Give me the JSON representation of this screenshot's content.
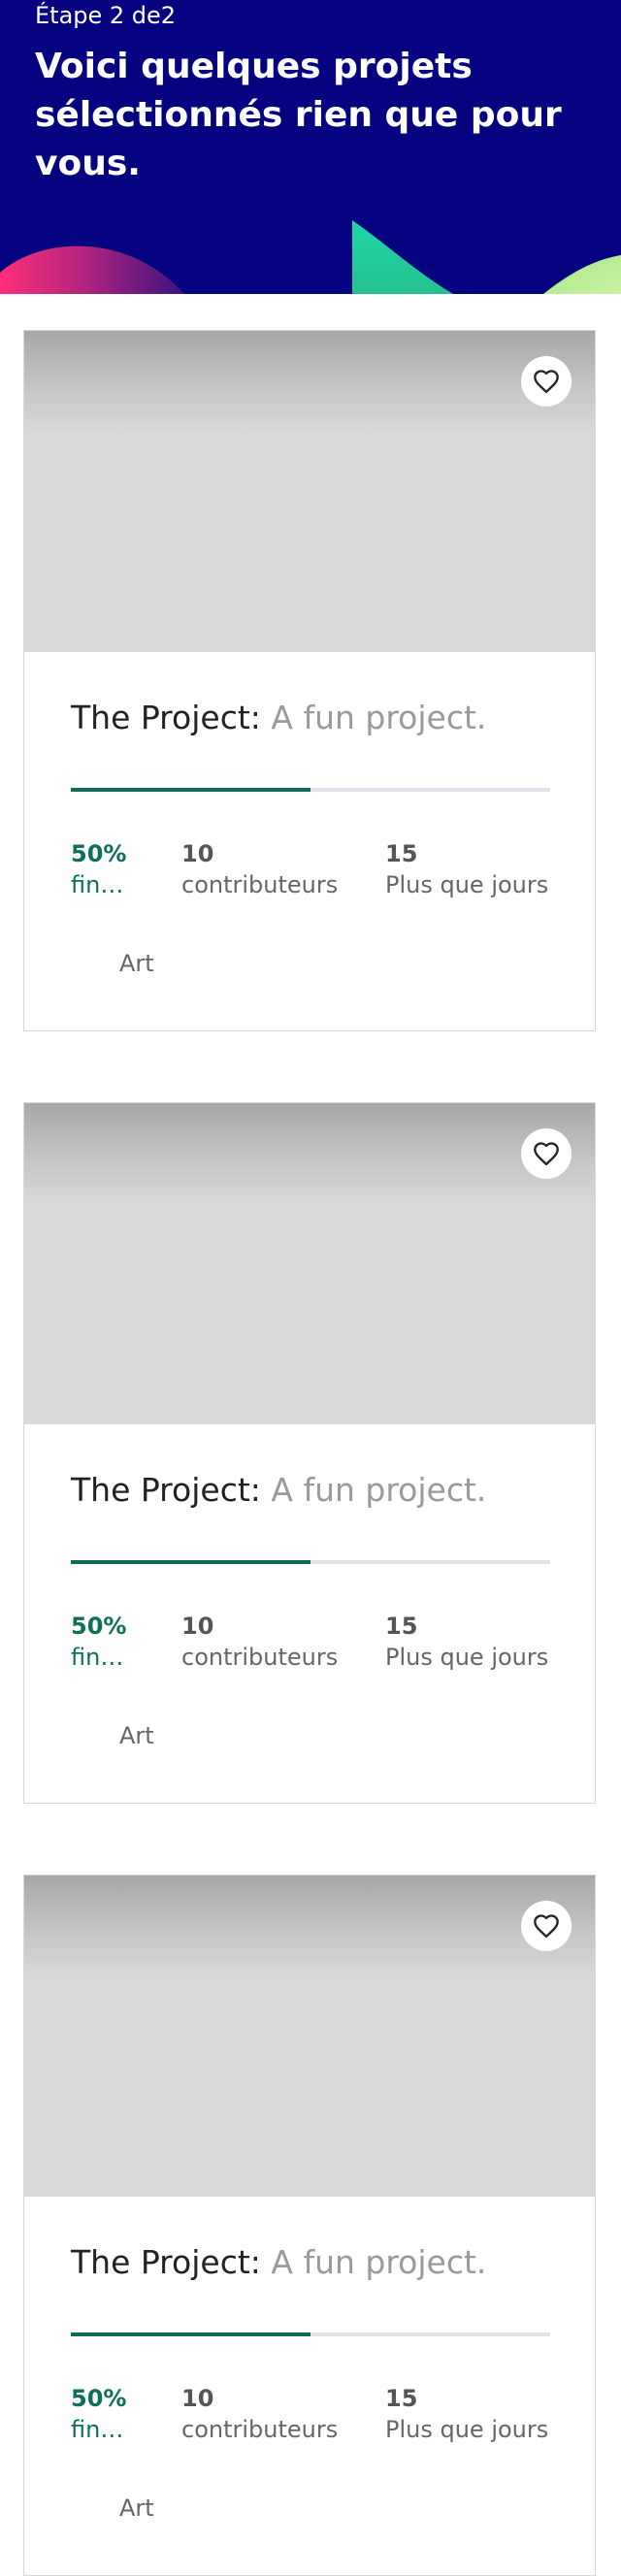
{
  "header": {
    "step": "Étape 2 de2",
    "headline": "Voici quelques projets sélectionnés rien que pour vous."
  },
  "colors": {
    "header_bg": "#050380",
    "accent_green": "#0e6f5a",
    "progress_track": "#e2e3ec"
  },
  "projects": [
    {
      "title": "The Project:",
      "subtitle": "A fun project.",
      "funded_percent": 50,
      "funded_value": "50%",
      "funded_label": "financé",
      "backers_value": "10",
      "backers_label": "contributeurs",
      "days_value": "15",
      "days_label": "Plus que jours",
      "category": "Art",
      "favorite_icon": "heart-icon"
    },
    {
      "title": "The Project:",
      "subtitle": "A fun project.",
      "funded_percent": 50,
      "funded_value": "50%",
      "funded_label": "financé",
      "backers_value": "10",
      "backers_label": "contributeurs",
      "days_value": "15",
      "days_label": "Plus que jours",
      "category": "Art",
      "favorite_icon": "heart-icon"
    },
    {
      "title": "The Project:",
      "subtitle": "A fun project.",
      "funded_percent": 50,
      "funded_value": "50%",
      "funded_label": "financé",
      "backers_value": "10",
      "backers_label": "contributeurs",
      "days_value": "15",
      "days_label": "Plus que jours",
      "category": "Art",
      "favorite_icon": "heart-icon"
    }
  ]
}
